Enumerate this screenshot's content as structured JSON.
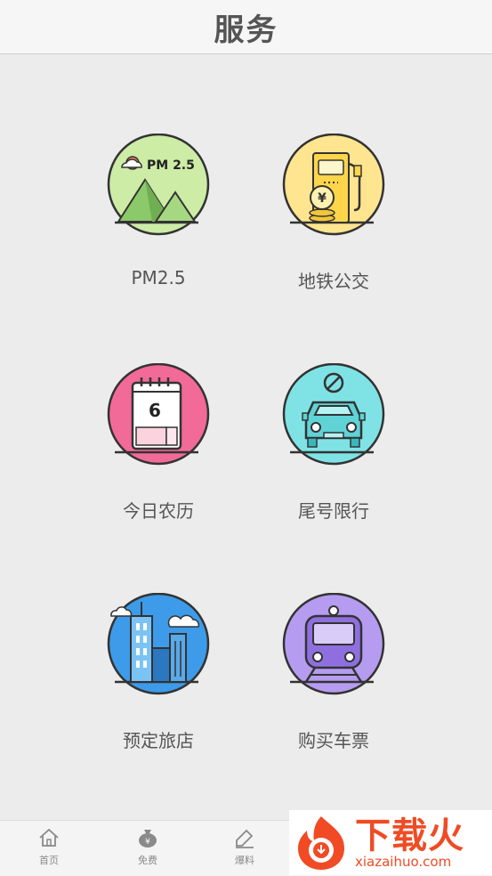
{
  "header": {
    "title": "服务"
  },
  "services": [
    {
      "label": "PM2.5",
      "icon": "air-quality-icon",
      "color": "#cdeca6",
      "icon_text": "PM 2.5"
    },
    {
      "label": "地铁公交",
      "icon": "fuel-pump-icon",
      "color": "#ffe58f",
      "icon_text": "¥"
    },
    {
      "label": "今日农历",
      "icon": "calendar-icon",
      "color": "#f26a98",
      "icon_text": "6"
    },
    {
      "label": "尾号限行",
      "icon": "car-restriction-icon",
      "color": "#7fe3e6"
    },
    {
      "label": "预定旅店",
      "icon": "city-buildings-icon",
      "color": "#3d9be9"
    },
    {
      "label": "购买车票",
      "icon": "train-icon",
      "color": "#b59cf0"
    }
  ],
  "tabbar": {
    "items": [
      {
        "label": "首页",
        "icon": "home-icon"
      },
      {
        "label": "免费",
        "icon": "money-bag-icon"
      },
      {
        "label": "爆料",
        "icon": "edit-icon"
      }
    ]
  },
  "watermark": {
    "text": "下载火",
    "url": "xiazaihuo.com",
    "color": "#f04b24"
  }
}
